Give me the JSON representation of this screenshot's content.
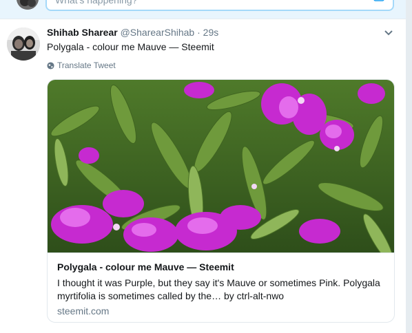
{
  "compose": {
    "placeholder": "What's happening?",
    "icons": [
      "avatar",
      "camera-icon"
    ]
  },
  "tweet": {
    "name": "Shihab Sharear",
    "handle": "@SharearShihab",
    "dot": "·",
    "time": "29s",
    "text": "Polygala - colour me Mauve — Steemit",
    "translate_label": "Translate Tweet",
    "card": {
      "title": "Polygala - colour me Mauve — Steemit",
      "description": "I thought it was Purple, but they say it's Mauve or sometimes Pink. Polygala myrtifolia is sometimes called by the… by ctrl-alt-nwo",
      "domain": "steemit.com"
    },
    "icons": [
      "chevron-down-icon",
      "globe-icon"
    ]
  },
  "colors": {
    "text_primary": "#14171a",
    "text_secondary": "#657786",
    "border": "#e1e8ed",
    "accent": "#1da1f2",
    "background": "#e6ecf0"
  }
}
